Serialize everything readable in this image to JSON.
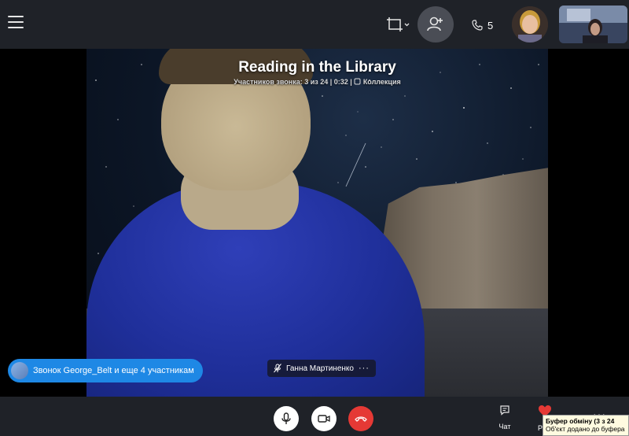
{
  "call": {
    "title": "Reading in the Library",
    "participants_info": "Участников звонка: 3 из 24 | 0:32 |",
    "collection_label": "Коллекция"
  },
  "header": {
    "participants_count": "5"
  },
  "speaker": {
    "name": "Ганна Мартиненко",
    "more": "···"
  },
  "notification": {
    "text": "Звонок George_Belt и еще 4 участникам"
  },
  "bottom": {
    "chat_label": "Чат",
    "react_label": "Р",
    "more": "···"
  },
  "clipboard_toast": {
    "title": "Буфер обміну (3 з 24",
    "message": "Об'єкт додано до буфера"
  },
  "colors": {
    "bar_bg": "#1f2228",
    "hangup": "#e53935",
    "notify": "#1e88e5",
    "heart": "#e53935"
  }
}
